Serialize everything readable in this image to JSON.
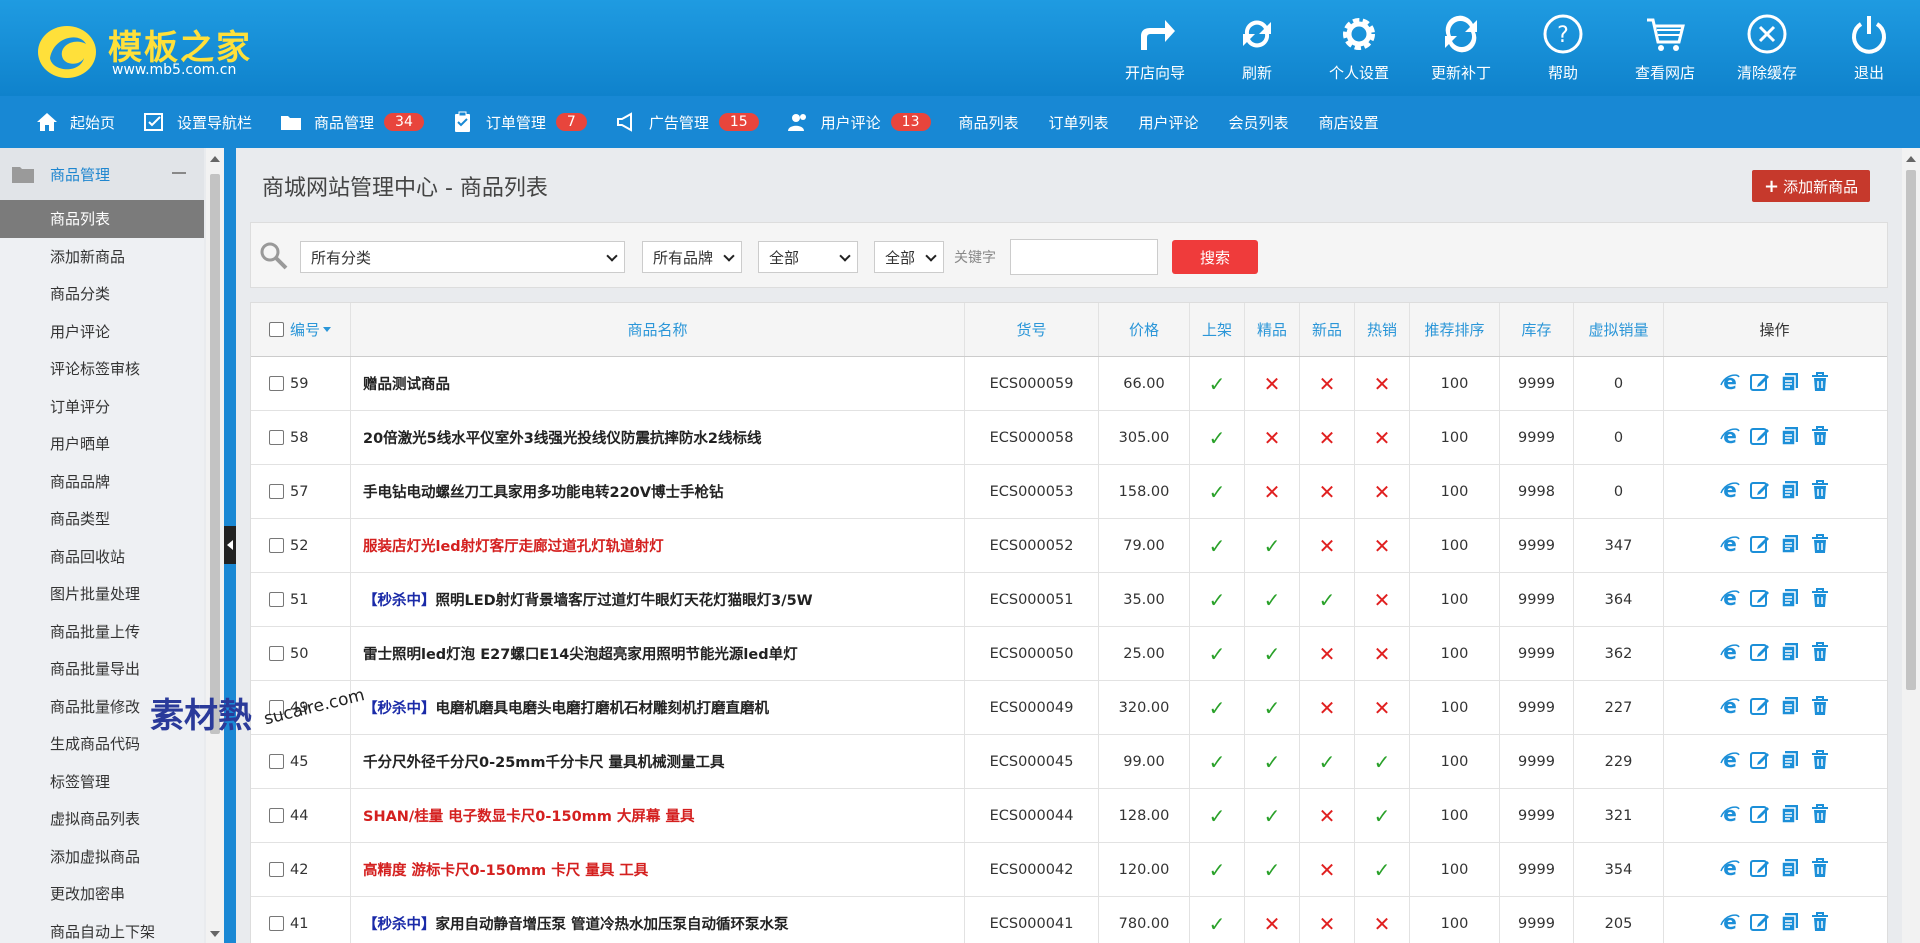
{
  "header": {
    "logo_title": "模板之家",
    "logo_url": "www.mb5.com.cn",
    "tools": [
      {
        "label": "开店向导",
        "icon": "redirect-arrow-icon"
      },
      {
        "label": "刷新",
        "icon": "refresh-icon"
      },
      {
        "label": "个人设置",
        "icon": "gear-icon"
      },
      {
        "label": "更新补丁",
        "icon": "sync-icon"
      },
      {
        "label": "帮助",
        "icon": "help-icon"
      },
      {
        "label": "查看网店",
        "icon": "cart-icon"
      },
      {
        "label": "清除缓存",
        "icon": "clear-icon"
      },
      {
        "label": "退出",
        "icon": "power-icon"
      }
    ]
  },
  "nav": {
    "items": [
      {
        "label": "起始页",
        "icon": "home-icon"
      },
      {
        "label": "设置导航栏",
        "icon": "checklist-icon"
      },
      {
        "label": "商品管理",
        "icon": "folder-icon",
        "badge": "34"
      },
      {
        "label": "订单管理",
        "icon": "clipboard-icon",
        "badge": "7"
      },
      {
        "label": "广告管理",
        "icon": "megaphone-icon",
        "badge": "15"
      },
      {
        "label": "用户评论",
        "icon": "users-icon",
        "badge": "13"
      }
    ],
    "plain": [
      "商品列表",
      "订单列表",
      "用户评论",
      "会员列表",
      "商店设置"
    ]
  },
  "sidebar": {
    "section": "商品管理",
    "items": [
      "商品列表",
      "添加新商品",
      "商品分类",
      "用户评论",
      "评论标签审核",
      "订单评分",
      "用户晒单",
      "商品品牌",
      "商品类型",
      "商品回收站",
      "图片批量处理",
      "商品批量上传",
      "商品批量导出",
      "商品批量修改",
      "生成商品代码",
      "标签管理",
      "虚拟商品列表",
      "添加虚拟商品",
      "更改加密串",
      "商品自动上下架"
    ],
    "active_index": 0
  },
  "main": {
    "title": "商城网站管理中心 - 商品列表",
    "add_button": "添加新商品",
    "filter": {
      "category": "所有分类",
      "brand": "所有品牌",
      "all1": "全部",
      "all2": "全部",
      "keyword_label": "关键字",
      "keyword_value": "",
      "search_button": "搜索"
    },
    "columns": [
      "编号",
      "商品名称",
      "货号",
      "价格",
      "上架",
      "精品",
      "新品",
      "热销",
      "推荐排序",
      "库存",
      "虚拟销量",
      "操作"
    ],
    "rows": [
      {
        "id": "59",
        "tag": "",
        "name": "赠品测试商品",
        "red": false,
        "sn": "ECS000059",
        "price": "66.00",
        "flags": [
          true,
          false,
          false,
          false
        ],
        "sort": "100",
        "stock": "9999",
        "sales": "0"
      },
      {
        "id": "58",
        "tag": "",
        "name": "20倍激光5线水平仪室外3线强光投线仪防震抗摔防水2线标线",
        "red": false,
        "sn": "ECS000058",
        "price": "305.00",
        "flags": [
          true,
          false,
          false,
          false
        ],
        "sort": "100",
        "stock": "9999",
        "sales": "0"
      },
      {
        "id": "57",
        "tag": "",
        "name": "手电钻电动螺丝刀工具家用多功能电转220V博士手枪钻",
        "red": false,
        "sn": "ECS000053",
        "price": "158.00",
        "flags": [
          true,
          false,
          false,
          false
        ],
        "sort": "100",
        "stock": "9998",
        "sales": "0"
      },
      {
        "id": "52",
        "tag": "",
        "name": "服装店灯光led射灯客厅走廊过道孔灯轨道射灯",
        "red": true,
        "sn": "ECS000052",
        "price": "79.00",
        "flags": [
          true,
          true,
          false,
          false
        ],
        "sort": "100",
        "stock": "9999",
        "sales": "347"
      },
      {
        "id": "51",
        "tag": "【秒杀中】",
        "name": "照明LED射灯背景墙客厅过道灯牛眼灯天花灯猫眼灯3/5W",
        "red": false,
        "sn": "ECS000051",
        "price": "35.00",
        "flags": [
          true,
          true,
          true,
          false
        ],
        "sort": "100",
        "stock": "9999",
        "sales": "364"
      },
      {
        "id": "50",
        "tag": "",
        "name": "雷士照明led灯泡 E27螺口E14尖泡超亮家用照明节能光源led单灯",
        "red": false,
        "sn": "ECS000050",
        "price": "25.00",
        "flags": [
          true,
          true,
          false,
          false
        ],
        "sort": "100",
        "stock": "9999",
        "sales": "362"
      },
      {
        "id": "49",
        "tag": "【秒杀中】",
        "name": "电磨机磨具电磨头电磨打磨机石材雕刻机打磨直磨机",
        "red": false,
        "sn": "ECS000049",
        "price": "320.00",
        "flags": [
          true,
          true,
          false,
          false
        ],
        "sort": "100",
        "stock": "9999",
        "sales": "227"
      },
      {
        "id": "45",
        "tag": "",
        "name": "千分尺外径千分尺0-25mm千分卡尺 量具机械测量工具",
        "red": false,
        "sn": "ECS000045",
        "price": "99.00",
        "flags": [
          true,
          true,
          true,
          true
        ],
        "sort": "100",
        "stock": "9999",
        "sales": "229"
      },
      {
        "id": "44",
        "tag": "",
        "name": "SHAN/桂量 电子数显卡尺0-150mm 大屏幕 量具",
        "red": true,
        "sn": "ECS000044",
        "price": "128.00",
        "flags": [
          true,
          true,
          false,
          true
        ],
        "sort": "100",
        "stock": "9999",
        "sales": "321"
      },
      {
        "id": "42",
        "tag": "",
        "name": "高精度 游标卡尺0-150mm 卡尺 量具 工具",
        "red": true,
        "sn": "ECS000042",
        "price": "120.00",
        "flags": [
          true,
          true,
          false,
          true
        ],
        "sort": "100",
        "stock": "9999",
        "sales": "354"
      },
      {
        "id": "41",
        "tag": "【秒杀中】",
        "name": "家用自动静音增压泵 管道冷热水加压泵自动循环泵水泵",
        "red": false,
        "sn": "ECS000041",
        "price": "780.00",
        "flags": [
          true,
          false,
          false,
          false
        ],
        "sort": "100",
        "stock": "9999",
        "sales": "205"
      }
    ]
  },
  "watermark": {
    "text": "素材熱",
    "url": "sucaire.com"
  },
  "colors": {
    "header": "#1f9be1",
    "nav": "#1888d4",
    "badge": "#e8453c",
    "ok": "#2aa12a",
    "no": "#e02020",
    "add": "#c6392c",
    "search": "#ef3b3b"
  }
}
